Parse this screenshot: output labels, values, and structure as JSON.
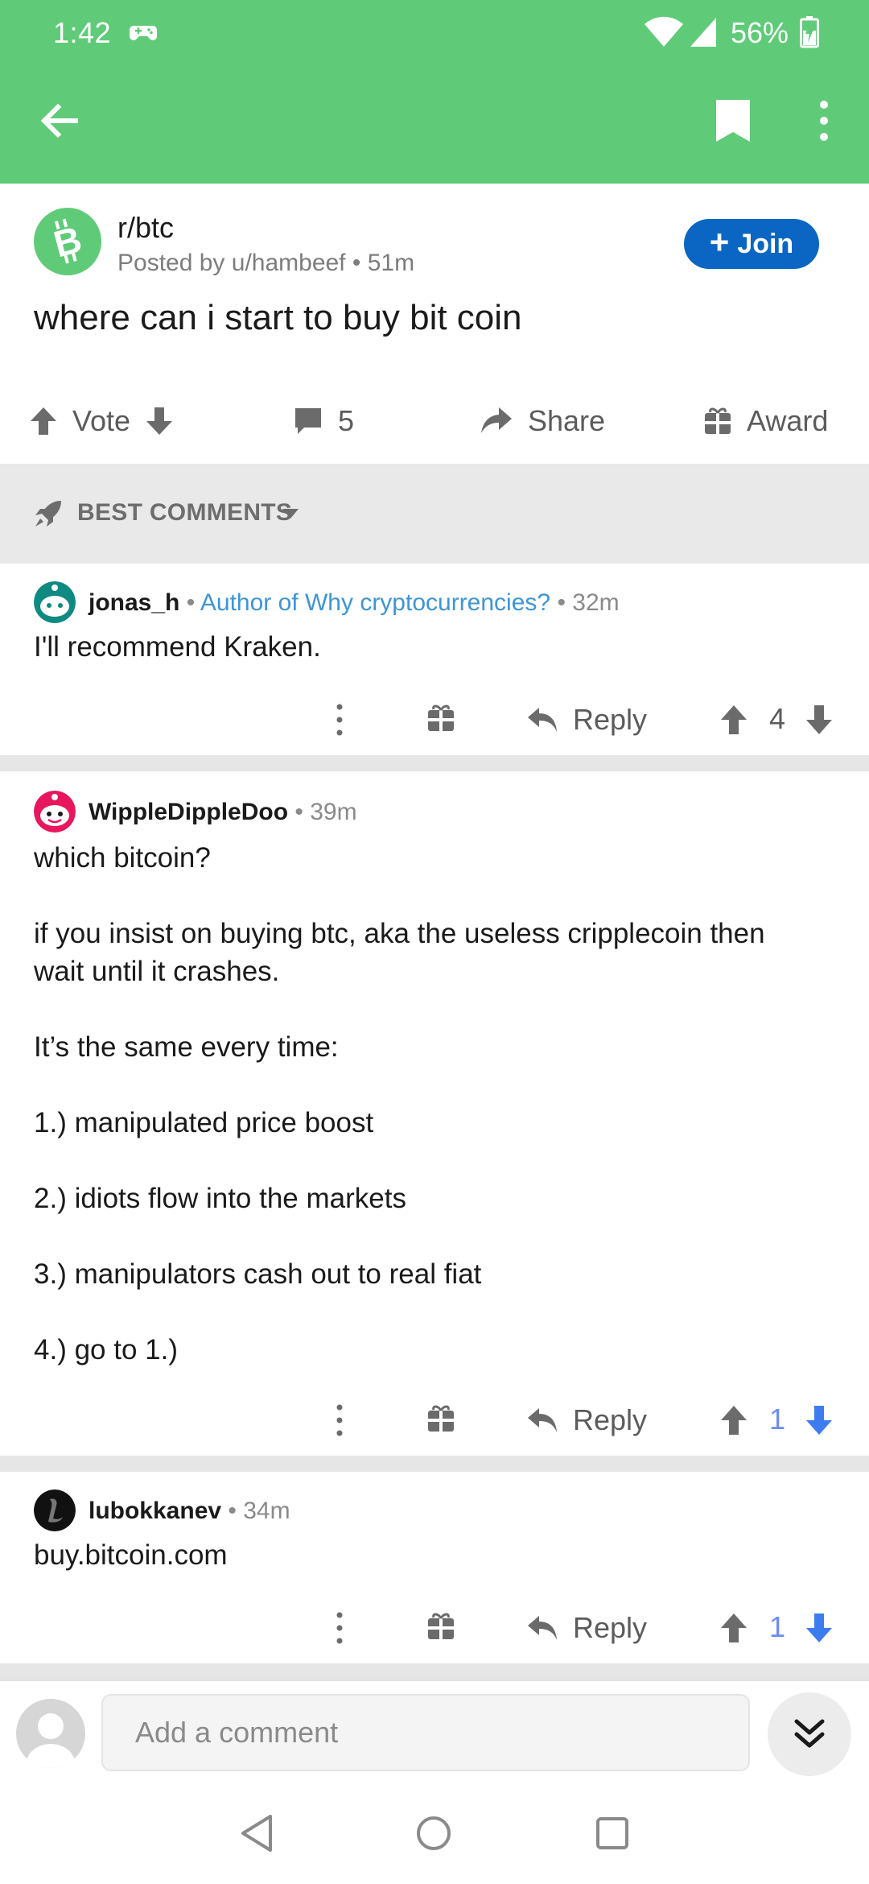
{
  "status_bar": {
    "time": "1:42",
    "battery_percent": "56%"
  },
  "colors": {
    "header_green": "#5fcb78",
    "join_blue": "#0a66c2",
    "flair_blue": "#3d95d6",
    "vote_blue": "#6b8cf0"
  },
  "post": {
    "subreddit": "r/btc",
    "posted_by": "Posted by u/hambeef • 51m",
    "join_label": "Join",
    "title": "where can i start to buy bit coin",
    "actions": {
      "vote_label": "Vote",
      "comment_count": "5",
      "share_label": "Share",
      "award_label": "Award"
    }
  },
  "sort": {
    "label": "BEST COMMENTS"
  },
  "comments": [
    {
      "user": "jonas_h",
      "flair": "Author of Why cryptocurrencies?",
      "age": "32m",
      "paragraphs": [
        "I'll recommend Kraken."
      ],
      "reply_label": "Reply",
      "score": "4"
    },
    {
      "user": "WippleDippleDoo",
      "age": "39m",
      "paragraphs": [
        "which bitcoin?",
        "if you insist on buying btc, aka the useless cripplecoin then wait until it crashes.",
        "It’s the same every time:",
        "1.) manipulated price boost",
        "2.) idiots flow into the markets",
        "3.) manipulators cash out to real fiat",
        "4.) go to 1.)"
      ],
      "reply_label": "Reply",
      "score": "1"
    },
    {
      "user": "lubokkanev",
      "age": "34m",
      "paragraphs": [
        "buy.bitcoin.com"
      ],
      "reply_label": "Reply",
      "score": "1"
    }
  ],
  "composer": {
    "placeholder": "Add a comment"
  }
}
